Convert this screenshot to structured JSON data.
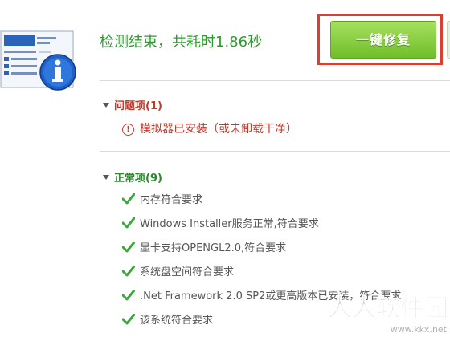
{
  "summary": {
    "headline": "检测结束，共耗时1.86秒",
    "fix_button_label": "一键修复"
  },
  "problems": {
    "title": "问题项(1)",
    "items": [
      {
        "label": "模拟器已安装（或未卸载干净）",
        "icon": "exclamation-circle-icon"
      }
    ]
  },
  "normal": {
    "title": "正常项(9)",
    "items": [
      {
        "label": "内存符合要求"
      },
      {
        "label": "Windows Installer服务正常,符合要求"
      },
      {
        "label": "显卡支持OPENGL2.0,符合要求"
      },
      {
        "label": "系统盘空间符合要求"
      },
      {
        "label": ".Net Framework 2.0 SP2或更高版本已安装，符合要求"
      },
      {
        "label": "该系统符合要求"
      }
    ]
  },
  "watermark": {
    "brand": "人人软件园",
    "url": "www.kkx.net"
  },
  "colors": {
    "accent_green": "#2e9a2e",
    "problem_red": "#c0392b",
    "button_green": "#6fbe2a",
    "highlight_frame": "#d84131"
  }
}
